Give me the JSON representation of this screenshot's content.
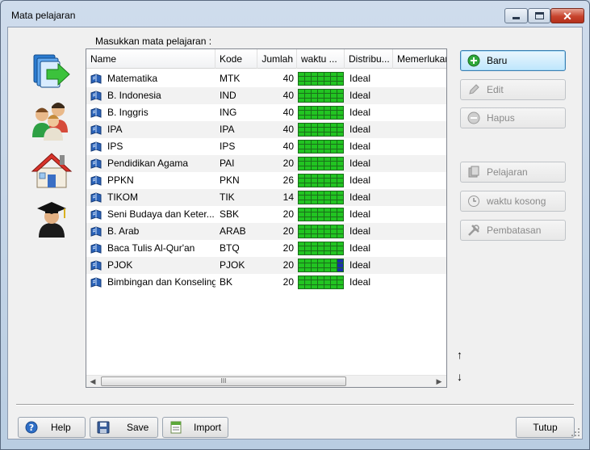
{
  "window": {
    "title": "Mata pelajaran"
  },
  "prompt_label": "Masukkan mata pelajaran :",
  "columns": [
    "Name",
    "Kode",
    "Jumlah",
    "waktu ...",
    "Distribu...",
    "Memerlukan"
  ],
  "rows": [
    {
      "name": "Matematika",
      "kode": "MTK",
      "jumlah": "40",
      "distribusi": "Ideal",
      "busy_cells": []
    },
    {
      "name": "B. Indonesia",
      "kode": "IND",
      "jumlah": "40",
      "distribusi": "Ideal",
      "busy_cells": []
    },
    {
      "name": "B. Inggris",
      "kode": "ING",
      "jumlah": "40",
      "distribusi": "Ideal",
      "busy_cells": []
    },
    {
      "name": "IPA",
      "kode": "IPA",
      "jumlah": "40",
      "distribusi": "Ideal",
      "busy_cells": []
    },
    {
      "name": "IPS",
      "kode": "IPS",
      "jumlah": "40",
      "distribusi": "Ideal",
      "busy_cells": []
    },
    {
      "name": "Pendidikan Agama",
      "kode": "PAI",
      "jumlah": "20",
      "distribusi": "Ideal",
      "busy_cells": []
    },
    {
      "name": "PPKN",
      "kode": "PKN",
      "jumlah": "26",
      "distribusi": "Ideal",
      "busy_cells": []
    },
    {
      "name": "TIKOM",
      "kode": "TIK",
      "jumlah": "14",
      "distribusi": "Ideal",
      "busy_cells": []
    },
    {
      "name": "Seni Budaya dan Keter...",
      "kode": "SBK",
      "jumlah": "20",
      "distribusi": "Ideal",
      "busy_cells": []
    },
    {
      "name": "B. Arab",
      "kode": "ARAB",
      "jumlah": "20",
      "distribusi": "Ideal",
      "busy_cells": []
    },
    {
      "name": "Baca Tulis Al-Qur'an",
      "kode": "BTQ",
      "jumlah": "20",
      "distribusi": "Ideal",
      "busy_cells": []
    },
    {
      "name": "PJOK",
      "kode": "PJOK",
      "jumlah": "20",
      "distribusi": "Ideal",
      "busy_cells": [
        6,
        13,
        20
      ]
    },
    {
      "name": "Bimbingan dan Konseling",
      "kode": "BK",
      "jumlah": "20",
      "distribusi": "Ideal",
      "busy_cells": []
    }
  ],
  "side_buttons": {
    "baru": "Baru",
    "edit": "Edit",
    "hapus": "Hapus",
    "pelajaran": "Pelajaran",
    "waktu_kosong": "waktu kosong",
    "pembatasan": "Pembatasan"
  },
  "order_arrows": {
    "up": "↑",
    "down": "↓"
  },
  "scroll_grip": "III",
  "bottom_buttons": {
    "help": "Help",
    "save": "Save",
    "import": "Import",
    "close": "Tutup"
  },
  "icons": {
    "window_icons": [
      "minimize-icon",
      "maximize-icon",
      "close-icon"
    ],
    "side_icons": [
      "subjects-transfer-icon",
      "teachers-group-icon",
      "school-house-icon",
      "graduate-icon"
    ],
    "row_icon": "subject-book-icon"
  },
  "colors": {
    "free_time": "#22c422",
    "busy_time": "#1a2fa8",
    "close_button": "#c7432c"
  }
}
